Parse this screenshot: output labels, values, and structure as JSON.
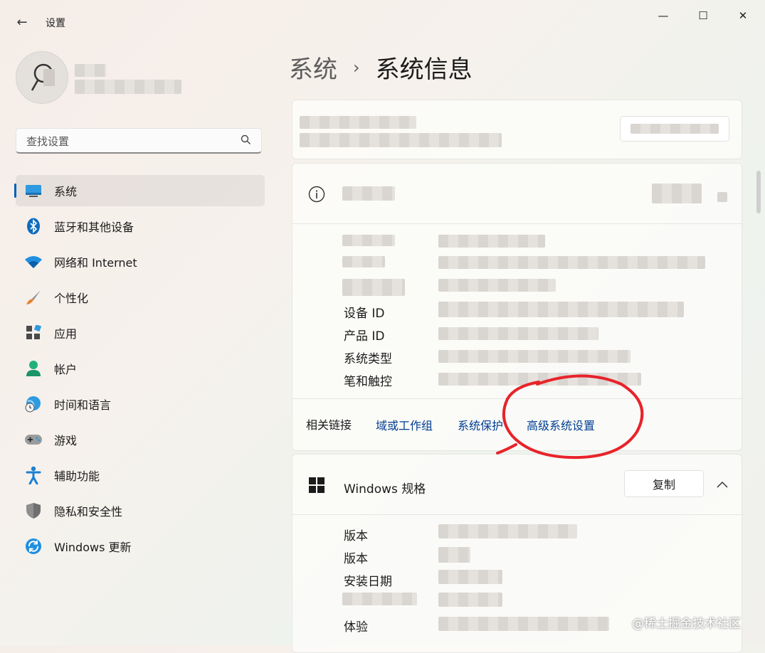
{
  "window": {
    "title": "设置",
    "back_glyph": "←",
    "minimize_glyph": "—",
    "maximize_glyph": "☐",
    "close_glyph": "✕"
  },
  "search": {
    "placeholder": "查找设置",
    "icon": "search-icon"
  },
  "sidebar": {
    "items": [
      {
        "label": "系统",
        "icon": "monitor-icon",
        "active": true
      },
      {
        "label": "蓝牙和其他设备",
        "icon": "bluetooth-icon"
      },
      {
        "label": "网络和 Internet",
        "icon": "wifi-icon"
      },
      {
        "label": "个性化",
        "icon": "brush-icon"
      },
      {
        "label": "应用",
        "icon": "apps-icon"
      },
      {
        "label": "帐户",
        "icon": "account-icon"
      },
      {
        "label": "时间和语言",
        "icon": "globe-clock-icon"
      },
      {
        "label": "游戏",
        "icon": "gamepad-icon"
      },
      {
        "label": "辅助功能",
        "icon": "accessibility-icon"
      },
      {
        "label": "隐私和安全性",
        "icon": "shield-icon"
      },
      {
        "label": "Windows 更新",
        "icon": "sync-icon"
      }
    ]
  },
  "breadcrumb": {
    "parent": "系统",
    "separator": "›",
    "current": "系统信息"
  },
  "device_specs": {
    "rows": [
      {
        "label": ""
      },
      {
        "label": ""
      },
      {
        "label": ""
      },
      {
        "label": "设备 ID"
      },
      {
        "label": "产品 ID"
      },
      {
        "label": "系统类型"
      },
      {
        "label": "笔和触控"
      }
    ]
  },
  "related_links": {
    "label": "相关链接",
    "links": [
      "域或工作组",
      "系统保护",
      "高级系统设置"
    ]
  },
  "windows_spec": {
    "title": "Windows 规格",
    "copy_label": "复制",
    "rows": [
      {
        "label": "版本"
      },
      {
        "label": "版本"
      },
      {
        "label": "安装日期"
      },
      {
        "label": ""
      },
      {
        "label": "体验"
      }
    ]
  },
  "watermark": "@稀土掘金技术社区",
  "colors": {
    "accent": "#005fb8",
    "link": "#003e92",
    "annotation": "#e8232a"
  }
}
